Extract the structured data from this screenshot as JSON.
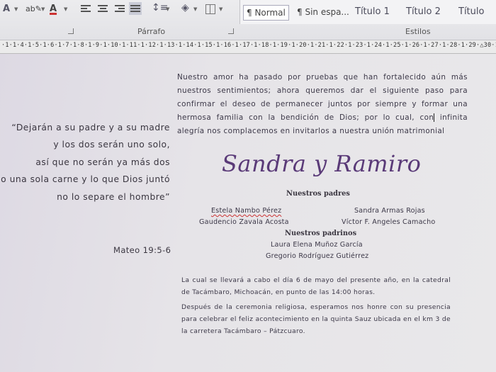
{
  "ribbon": {
    "paragraph_group": "Párrafo",
    "styles_group": "Estilos",
    "styles": [
      "¶ Normal",
      "¶ Sin espa...",
      "Título 1",
      "Título 2",
      "Título"
    ]
  },
  "ruler": {
    "text": "·1·1·4·1·5·1·6·1·7·1·8·1·9·1·10·1·11·1·12·1·13·1·14·1·15·1·16·1·17·1·18·1·19·1·20·1·21·1·22·1·23·1·24·1·25·1·26·1·27·1·28·1·29·△30·1"
  },
  "document": {
    "intro_before_cursor": "Nuestro amor ha pasado por pruebas que han fortalecido aún más nuestros sentimientos; ahora queremos dar el siguiente paso para confirmar el deseo de permanecer juntos por siempre y formar una hermosa familia con la bendición de Dios; por lo cual, con",
    "intro_after_cursor": " infinita alegría nos complacemos en invitarlos a nuestra unión matrimonial",
    "verse_lines": [
      "“Dejarán a su padre y a su madre",
      "y los dos serán uno solo,",
      "así que no serán ya más dos",
      "sino una sola carne y lo que Dios juntó",
      "no lo separe el hombre”"
    ],
    "verse_ref": "Mateo 19:5-6",
    "couple_names": "Sandra y Ramiro",
    "parents_heading": "Nuestros padres",
    "parents_left": [
      "Estela Nambo Pérez",
      "Gaudencio Zavala Acosta"
    ],
    "parents_right": [
      "Sandra Armas Rojas",
      "Víctor F. Angeles Camacho"
    ],
    "godparents_heading": "Nuestros padrinos",
    "godparents": [
      "Laura Elena Muñoz García",
      "Gregorio Rodríguez Gutiérrez"
    ],
    "details_1": "La cual se llevará a cabo el día 6 de mayo del presente año, en la catedral de Tacámbaro, Michoacán, en punto de las 14:00 horas.",
    "details_2": "Después de la ceremonia religiosa, esperamos nos honre con su presencia para celebrar el feliz acontecimiento en la quinta Sauz ubicada en el km 3 de la carretera Tacámbaro – Pátzcuaro."
  }
}
